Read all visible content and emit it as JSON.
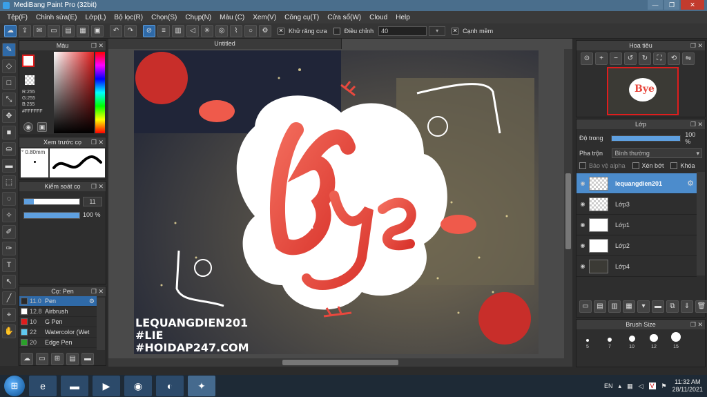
{
  "app": {
    "title": "MediBang Paint Pro (32bit)",
    "window_buttons": [
      "—",
      "❐",
      "✕"
    ]
  },
  "menu": [
    "Tệp(F)",
    "Chỉnh sửa(E)",
    "Lớp(L)",
    "Bộ lọc(R)",
    "Chọn(S)",
    "Chụp(N)",
    "Màu (C)",
    "Xem(V)",
    "Công cụ(T)",
    "Cửa sổ(W)",
    "Cloud",
    "Help"
  ],
  "toolbar": {
    "antialias_label": "Khử răng cưa",
    "adjust_label": "Điều chỉnh",
    "adjust_value": "40",
    "snap_label": "Cạnh mềm"
  },
  "color_panel": {
    "title": "Màu",
    "r": "R:255",
    "g": "G:255",
    "b": "B:255",
    "hex": "#FFFFFF"
  },
  "preview_panel": {
    "title": "Xem trước cọ",
    "size": "° 0.80mm"
  },
  "stroke_panel": {
    "title": "Kiểm soát cọ",
    "value1": "11",
    "value2": "100 %",
    "percent": 100
  },
  "brush_panel": {
    "title": "Cọ: Pen",
    "items": [
      {
        "size": "11.0",
        "name": "Pen",
        "color": "#2b2b2b"
      },
      {
        "size": "12.8",
        "name": "Airbrush",
        "color": "#ffffff"
      },
      {
        "size": "10",
        "name": "G Pen",
        "color": "#e01d1d"
      },
      {
        "size": "22",
        "name": "Watercolor (Wet",
        "color": "#5fc8ee"
      },
      {
        "size": "20",
        "name": "Edge Pen",
        "color": "#2aa02a"
      }
    ]
  },
  "document": {
    "tab": "Untitled"
  },
  "artwork": {
    "lines": [
      "LEQUANGDIEN201",
      "#LIE",
      "#HOIDAP247.COM"
    ],
    "big_text": "Bye"
  },
  "navigator_panel": {
    "title": "Hoa tiêu"
  },
  "layer_panel": {
    "title": "Lớp",
    "opacity_label": "Độ trong",
    "opacity_value": "100 %",
    "blend_label": "Pha trộn",
    "blend_value": "Bình thường",
    "protect_alpha": "Bảo vệ alpha",
    "clip": "Xén bớt",
    "lock": "Khóa",
    "layers": [
      {
        "name": "lequangdien201",
        "selected": true
      },
      {
        "name": "Lớp3",
        "selected": false
      },
      {
        "name": "Lớp1",
        "selected": false
      },
      {
        "name": "Lớp2",
        "selected": false
      },
      {
        "name": "Lớp4",
        "selected": false
      }
    ]
  },
  "brush_size_panel": {
    "title": "Brush Size",
    "sizes": [
      "5",
      "7",
      "10",
      "12",
      "15"
    ]
  },
  "taskbar": {
    "lang": "EN",
    "time": "11:32 AM",
    "date": "28/11/2021"
  },
  "colors": {
    "accent": "#4c8ccc",
    "titlebar": "#4a6e8c",
    "art_red": "#e8483e"
  }
}
